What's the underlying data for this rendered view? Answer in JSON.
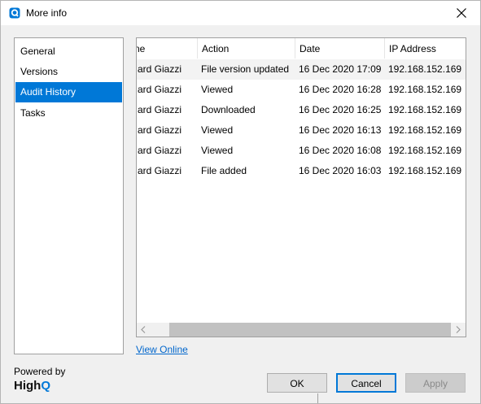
{
  "window": {
    "title": "More info",
    "accent": "#0078d7"
  },
  "nav": {
    "items": [
      {
        "label": "General",
        "selected": false
      },
      {
        "label": "Versions",
        "selected": false
      },
      {
        "label": "Audit History",
        "selected": true
      },
      {
        "label": "Tasks",
        "selected": false
      }
    ]
  },
  "table": {
    "columns": [
      "ne",
      "Action",
      "Date",
      "IP Address"
    ],
    "rows": [
      [
        "ard Giazzi",
        "File version updated",
        "16 Dec 2020 17:09",
        "192.168.152.169"
      ],
      [
        "ard Giazzi",
        "Viewed",
        "16 Dec 2020 16:28",
        "192.168.152.169"
      ],
      [
        "ard Giazzi",
        "Downloaded",
        "16 Dec 2020 16:25",
        "192.168.152.169"
      ],
      [
        "ard Giazzi",
        "Viewed",
        "16 Dec 2020 16:13",
        "192.168.152.169"
      ],
      [
        "ard Giazzi",
        "Viewed",
        "16 Dec 2020 16:08",
        "192.168.152.169"
      ],
      [
        "ard Giazzi",
        "File added",
        "16 Dec 2020 16:03",
        "192.168.152.169"
      ]
    ]
  },
  "links": {
    "view_online": "View Online"
  },
  "branding": {
    "powered_by": "Powered by",
    "logo_high": "High",
    "logo_q": "Q"
  },
  "buttons": {
    "ok": "OK",
    "cancel": "Cancel",
    "apply": "Apply"
  },
  "icons": {
    "app": "highq-q-icon",
    "close": "close-icon",
    "scroll_left": "chevron-left-icon",
    "scroll_right": "chevron-right-icon"
  }
}
